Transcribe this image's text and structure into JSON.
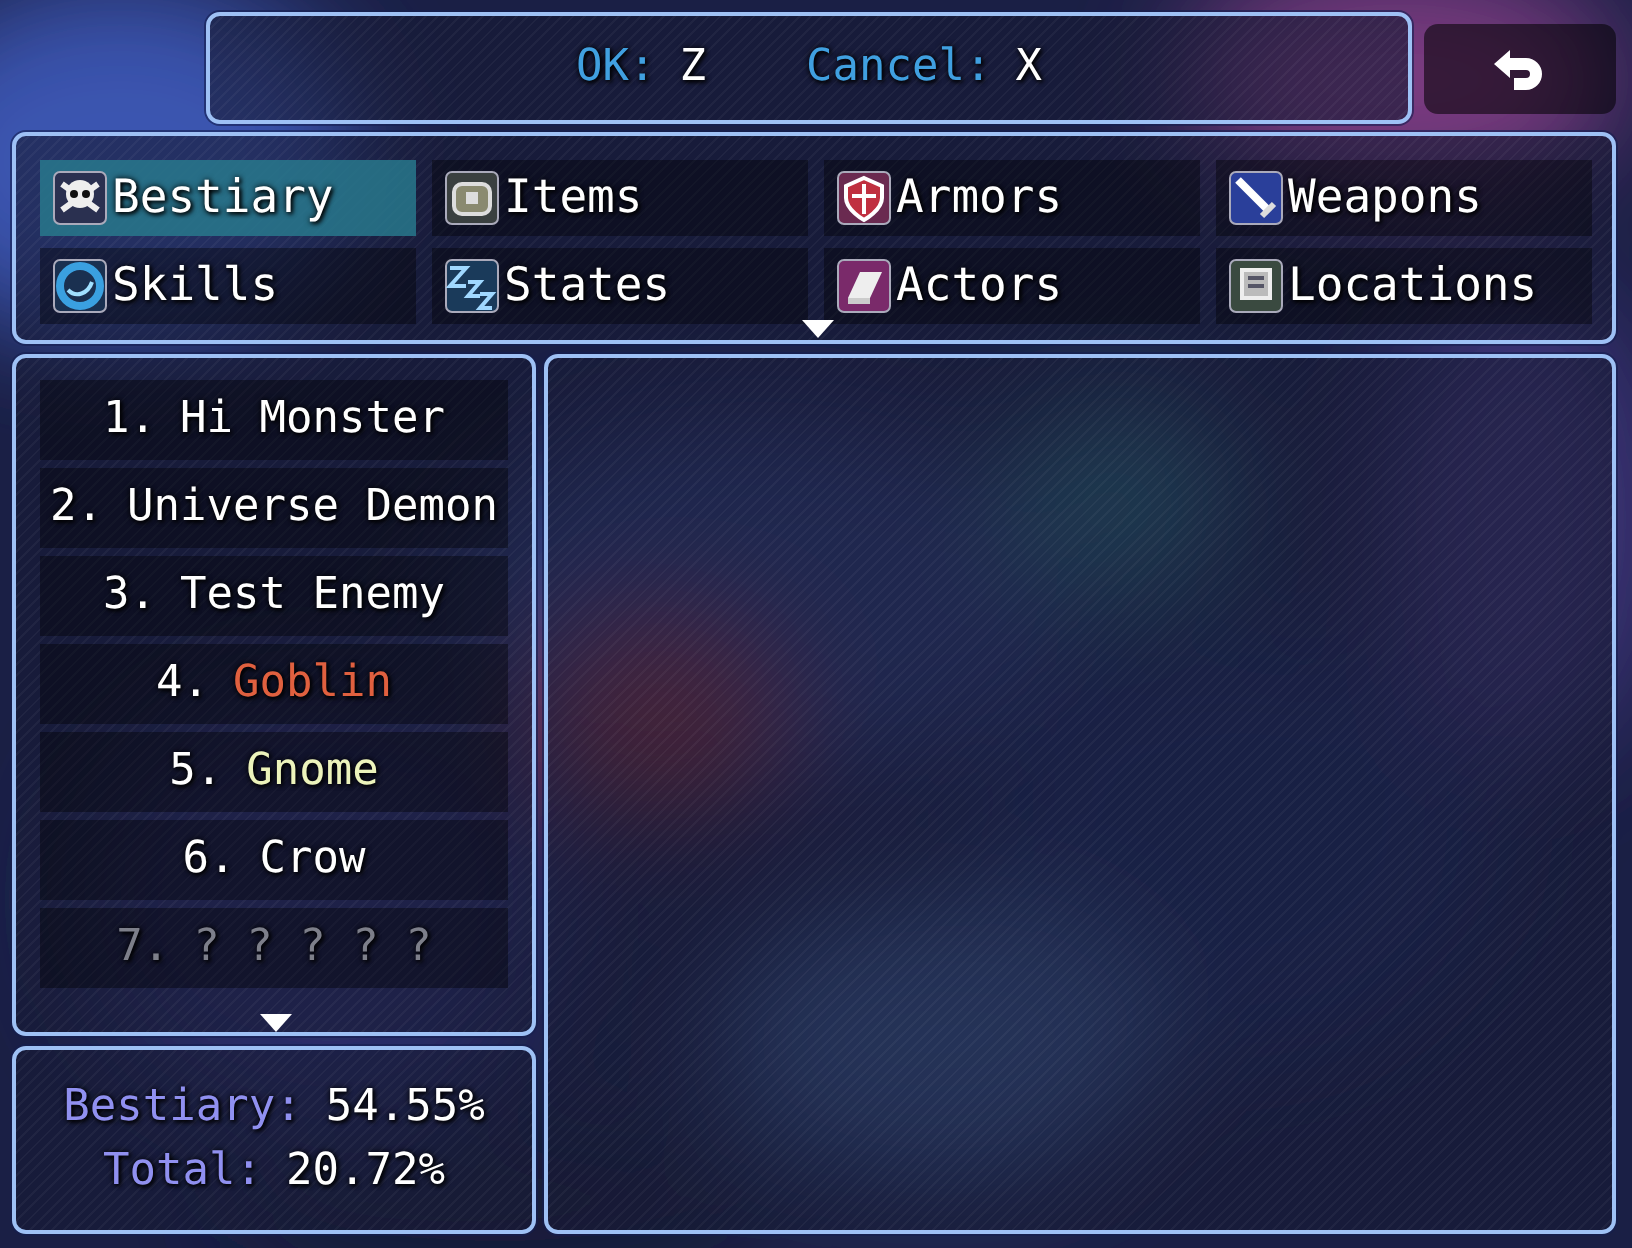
{
  "help": [
    {
      "label": "OK:",
      "value": "Z"
    },
    {
      "label": "Cancel:",
      "value": "X"
    }
  ],
  "categories": [
    {
      "label": "Bestiary",
      "selected": true
    },
    {
      "label": "Items",
      "selected": false
    },
    {
      "label": "Armors",
      "selected": false
    },
    {
      "label": "Weapons",
      "selected": false
    },
    {
      "label": "Skills",
      "selected": false
    },
    {
      "label": "States",
      "selected": false
    },
    {
      "label": "Actors",
      "selected": false
    },
    {
      "label": "Locations",
      "selected": false
    }
  ],
  "entries": [
    {
      "number": "1.",
      "name": "Hi Monster",
      "known": true,
      "color": "#ffffff"
    },
    {
      "number": "2.",
      "name": "Universe Demon",
      "known": true,
      "color": "#ffffff"
    },
    {
      "number": "3.",
      "name": "Test Enemy",
      "known": true,
      "color": "#ffffff"
    },
    {
      "number": "4.",
      "name": "Goblin",
      "known": true,
      "color": "#e0603f"
    },
    {
      "number": "5.",
      "name": "Gnome",
      "known": true,
      "color": "#ecf3bb"
    },
    {
      "number": "6.",
      "name": "Crow",
      "known": true,
      "color": "#ffffff"
    },
    {
      "number": "7.",
      "name": "? ? ? ? ?",
      "known": false
    }
  ],
  "stats": [
    {
      "label": "Bestiary:",
      "value": "54.55%"
    },
    {
      "label": "Total:",
      "value": "20.72%"
    }
  ]
}
